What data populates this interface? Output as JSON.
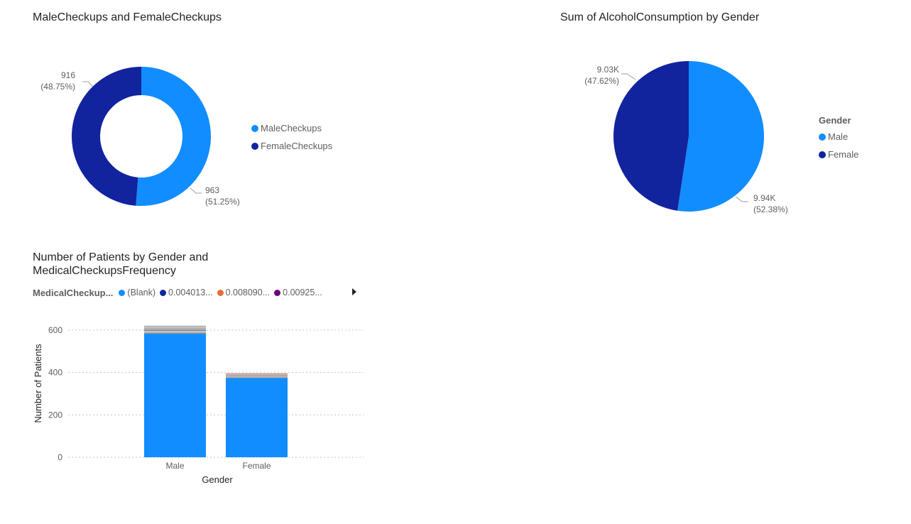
{
  "colors": {
    "male": "#118DFF",
    "female": "#12239E",
    "series3": "#E66C37",
    "series4": "#6B007B",
    "grid": "#c8c6c4",
    "text": "#605e5c"
  },
  "donut": {
    "title": "MaleCheckups and FemaleCheckups",
    "legend": [
      {
        "label": "MaleCheckups",
        "color": "#118DFF"
      },
      {
        "label": "FemaleCheckups",
        "color": "#12239E"
      }
    ],
    "labels": {
      "female_value": "916",
      "female_pct": "(48.75%)",
      "male_value": "963",
      "male_pct": "(51.25%)"
    }
  },
  "pie": {
    "title": "Sum of AlcoholConsumption by Gender",
    "legend_title": "Gender",
    "legend": [
      {
        "label": "Male",
        "color": "#118DFF"
      },
      {
        "label": "Female",
        "color": "#12239E"
      }
    ],
    "labels": {
      "female_value": "9.03K",
      "female_pct": "(47.62%)",
      "male_value": "9.94K",
      "male_pct": "(52.38%)"
    }
  },
  "bar": {
    "title": "Number of Patients by Gender and\nMedicalCheckupsFrequency",
    "legend_title": "MedicalCheckup...",
    "legend": [
      {
        "label": "(Blank)",
        "color": "#118DFF"
      },
      {
        "label": "0.004013...",
        "color": "#12239E"
      },
      {
        "label": "0.008090...",
        "color": "#E66C37"
      },
      {
        "label": "0.00925...",
        "color": "#6B007B"
      }
    ],
    "xlabel": "Gender",
    "ylabel": "Number of Patients"
  },
  "chart_data": [
    {
      "type": "pie",
      "variant": "donut",
      "title": "MaleCheckups and FemaleCheckups",
      "categories": [
        "MaleCheckups",
        "FemaleCheckups"
      ],
      "values": [
        963,
        916
      ],
      "percentages": [
        51.25,
        48.75
      ],
      "legend": "right"
    },
    {
      "type": "pie",
      "title": "Sum of AlcoholConsumption by Gender",
      "categories": [
        "Male",
        "Female"
      ],
      "values": [
        9940,
        9030
      ],
      "percentages": [
        52.38,
        47.62
      ],
      "legend": "right"
    },
    {
      "type": "bar",
      "stacked": true,
      "title": "Number of Patients by Gender and MedicalCheckupsFrequency",
      "categories": [
        "Male",
        "Female"
      ],
      "series": [
        {
          "name": "(Blank)",
          "values": [
            583,
            374
          ]
        },
        {
          "values": [
            5,
            3
          ]
        },
        {
          "values": [
            9,
            6
          ]
        },
        {
          "values": [
            5,
            3
          ]
        },
        {
          "values": [
            6,
            3
          ]
        },
        {
          "values": [
            4,
            2
          ]
        },
        {
          "values": [
            5,
            2
          ]
        },
        {
          "values": [
            4,
            3
          ]
        }
      ],
      "xlabel": "Gender",
      "ylabel": "Number of Patients",
      "yticks": [
        0,
        200,
        400,
        600
      ],
      "ylim": [
        0,
        640
      ],
      "grid": true,
      "legend": "top"
    }
  ]
}
